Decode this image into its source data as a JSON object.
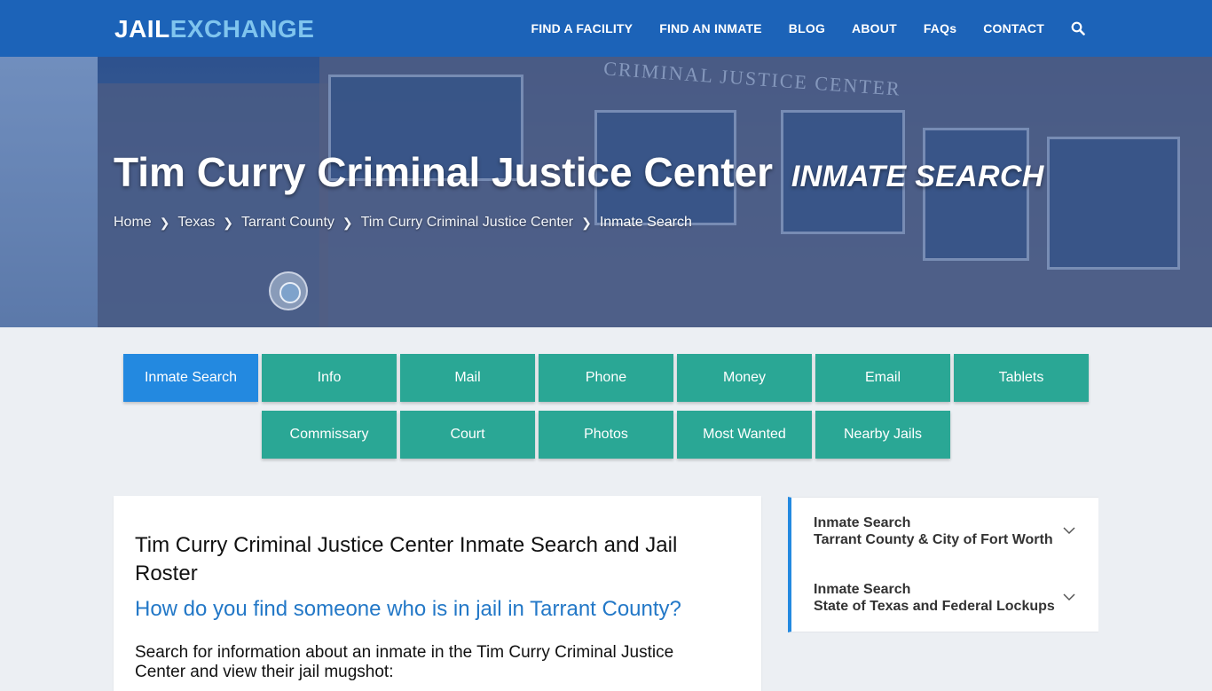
{
  "logo": {
    "part1": "JAIL",
    "part2": "EXCHANGE"
  },
  "nav": {
    "items": [
      "FIND A FACILITY",
      "FIND AN INMATE",
      "BLOG",
      "ABOUT",
      "FAQs",
      "CONTACT"
    ],
    "search_icon": "search-icon"
  },
  "hero": {
    "title": "Tim Curry Criminal Justice Center",
    "subtitle": "INMATE SEARCH",
    "building_sign": "CRIMINAL JUSTICE CENTER"
  },
  "breadcrumb": [
    "Home",
    "Texas",
    "Tarrant County",
    "Tim Curry Criminal Justice Center",
    "Inmate Search"
  ],
  "buttons_row1": [
    "Inmate Search",
    "Info",
    "Mail",
    "Phone",
    "Money",
    "Email",
    "Tablets"
  ],
  "buttons_row2": [
    "Commissary",
    "Court",
    "Photos",
    "Most Wanted",
    "Nearby Jails"
  ],
  "main": {
    "heading": "Tim Curry Criminal Justice Center Inmate Search and Jail Roster",
    "question": "How do you find someone who is in jail in Tarrant County?",
    "intro": "Search for information about an inmate in the Tim Curry Criminal Justice Center and view their jail mugshot:"
  },
  "sidebar": {
    "items": [
      {
        "line1": "Inmate Search",
        "line2": "Tarrant County & City of Fort Worth"
      },
      {
        "line1": "Inmate Search",
        "line2": "State of Texas and Federal Lockups"
      }
    ]
  },
  "colors": {
    "nav_bg": "#1c63b8",
    "button_teal": "#2aa795",
    "button_active": "#2389e0",
    "link_blue": "#2378c7"
  }
}
